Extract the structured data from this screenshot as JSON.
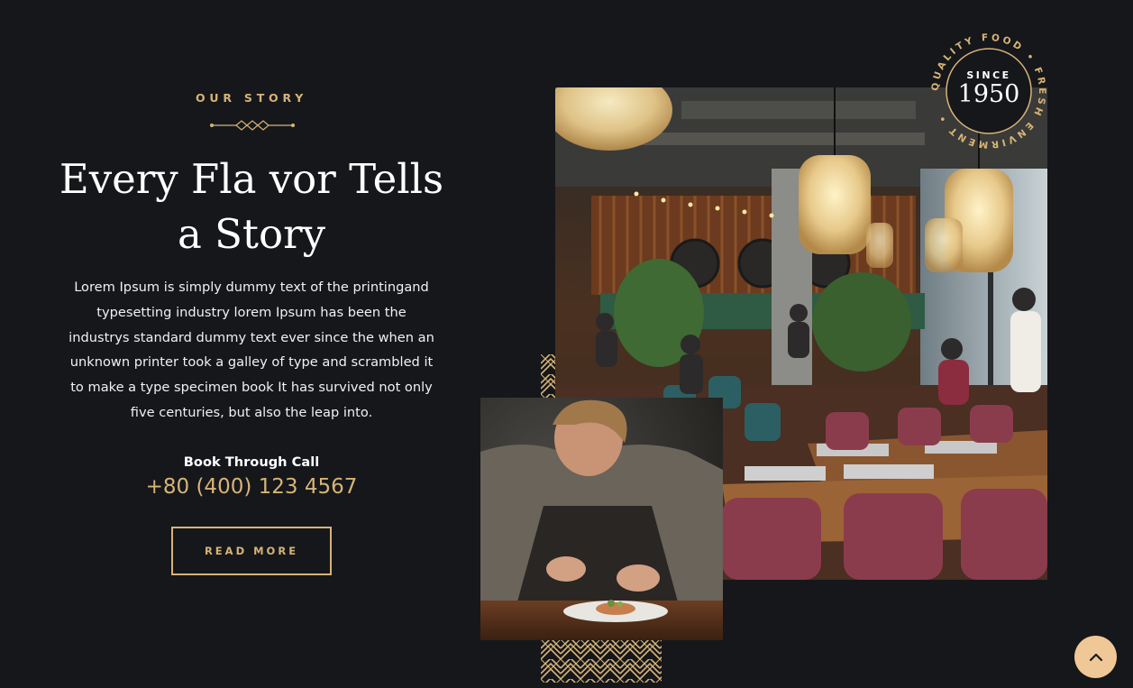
{
  "story": {
    "eyebrow": "OUR STORY",
    "heading": "Every Fla vor Tells a Story",
    "body": "Lorem Ipsum is simply dummy text of the printingand typesetting industry lorem Ipsum has been the industrys standard dummy text ever since the when an unknown printer took a galley of type and scrambled it to make a type specimen book It has survived not only five centuries, but also the leap into.",
    "book_label": "Book Through Call",
    "phone": "+80 (400) 123 4567",
    "button_label": "READ MORE"
  },
  "badge": {
    "ring_text": "QUALITY FOOD • FRESH ENVIRMENT •",
    "since": "SINCE",
    "year": "1950"
  },
  "colors": {
    "background": "#16171b",
    "accent": "#d6b476",
    "scroll_button": "#f0c796"
  },
  "icons": {
    "scroll_top": "chevron-up-icon"
  }
}
